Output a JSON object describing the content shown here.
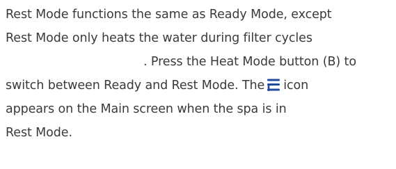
{
  "document": {
    "lines": [
      "Rest Mode functions the same as Ready Mode, except",
      "Rest Mode only heats the water during filter cycles",
      ". Press the Heat Mode button (B) to",
      "switch between Ready and Rest Mode. The",
      "icon",
      "appears on the Main screen when the spa is in",
      "Rest Mode."
    ],
    "icon": {
      "name": "rest-mode-icon",
      "color": "#1f4aa0"
    }
  }
}
